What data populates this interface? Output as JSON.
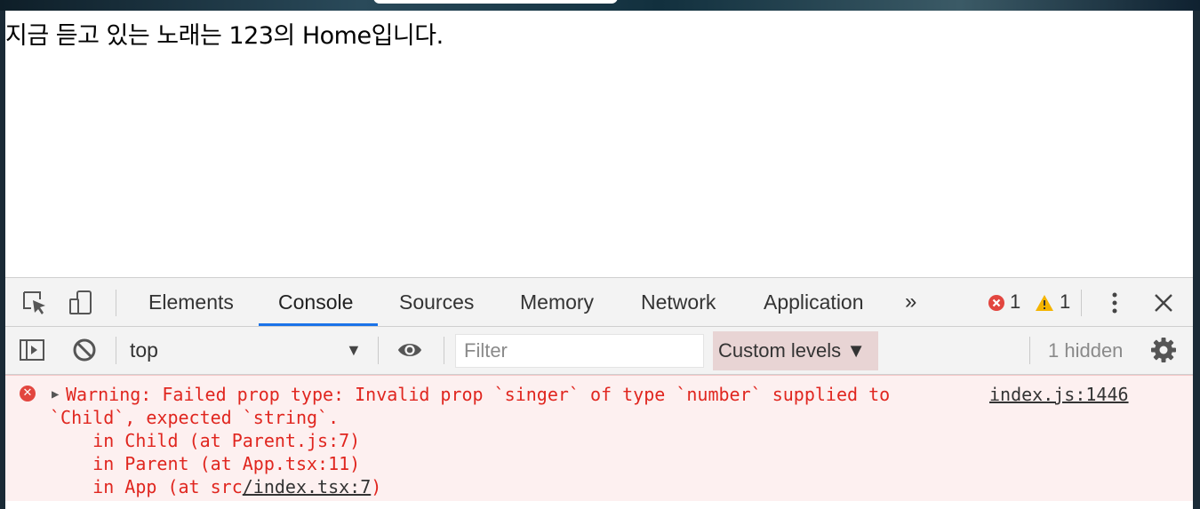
{
  "page": {
    "text": "지금 듣고 있는 노래는 123의 Home입니다."
  },
  "devtools": {
    "tabs": [
      "Elements",
      "Console",
      "Sources",
      "Memory",
      "Network",
      "Application"
    ],
    "active_tab": "Console",
    "more_tabs_label": "»",
    "error_count": "1",
    "warning_count": "1",
    "icons": {
      "inspect": "inspect-element-icon",
      "device": "device-toolbar-icon",
      "more_options": "vertical-dots-icon",
      "close": "close-icon",
      "sidebar": "console-sidebar-icon",
      "clear": "clear-console-icon",
      "eye": "live-expression-icon",
      "settings": "gear-icon"
    },
    "colors": {
      "accent": "#1a73e8",
      "error": "#e0261f",
      "warning": "#f4b400",
      "error_bg": "#fdf0f0"
    }
  },
  "console_toolbar": {
    "context": "top",
    "filter_placeholder": "Filter",
    "levels_label": "Custom levels ▼",
    "hidden_label": "1 hidden"
  },
  "message": {
    "line1": "Warning: Failed prop type: Invalid prop `singer` of type `number` supplied to",
    "line2": "`Child`, expected `string`.",
    "line3": "    in Child (at Parent.js:7)",
    "line4": "    in Parent (at App.tsx:11)",
    "line5_prefix": "    in App (at src",
    "line5_link": "/index.tsx:7",
    "line5_suffix": ")",
    "source": "index.js:1446"
  }
}
